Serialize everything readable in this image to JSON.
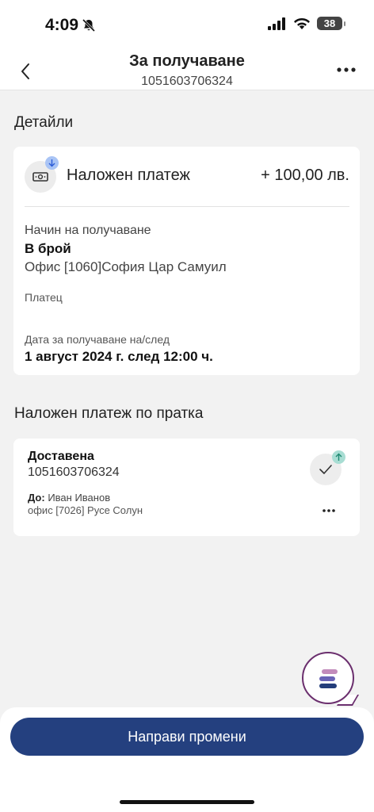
{
  "status_bar": {
    "time": "4:09",
    "battery": "38"
  },
  "header": {
    "title": "За получаване",
    "subtitle": "1051603706324"
  },
  "details": {
    "section_title": "Детайли",
    "cod_label": "Наложен платеж",
    "cod_amount": "+ 100,00 лв.",
    "receive_method_label": "Начин на получаване",
    "receive_method_value": "В брой",
    "office": "Офис [1060]София Цар Самуил",
    "payer_label": "Платец",
    "date_label": "Дата за получаване на/след",
    "date_value": "1 август 2024 г. след 12:00 ч."
  },
  "shipment": {
    "section_title": "Наложен платеж по пратка",
    "status": "Доставена",
    "number": "1051603706324",
    "to_label": "До:",
    "to_name": "Иван Иванов",
    "office": "офис [7026] Русе Солун"
  },
  "actions": {
    "primary_label": "Направи промени"
  },
  "colors": {
    "primary": "#24407f",
    "chat_accent": "#6b2f6e",
    "background": "#f2f2f2"
  },
  "icons": [
    "bell-off-icon",
    "signal-icon",
    "wifi-icon",
    "battery-icon",
    "back-icon",
    "more-icon",
    "money-icon",
    "arrow-down-icon",
    "check-icon",
    "arrow-up-icon",
    "chat-icon"
  ]
}
